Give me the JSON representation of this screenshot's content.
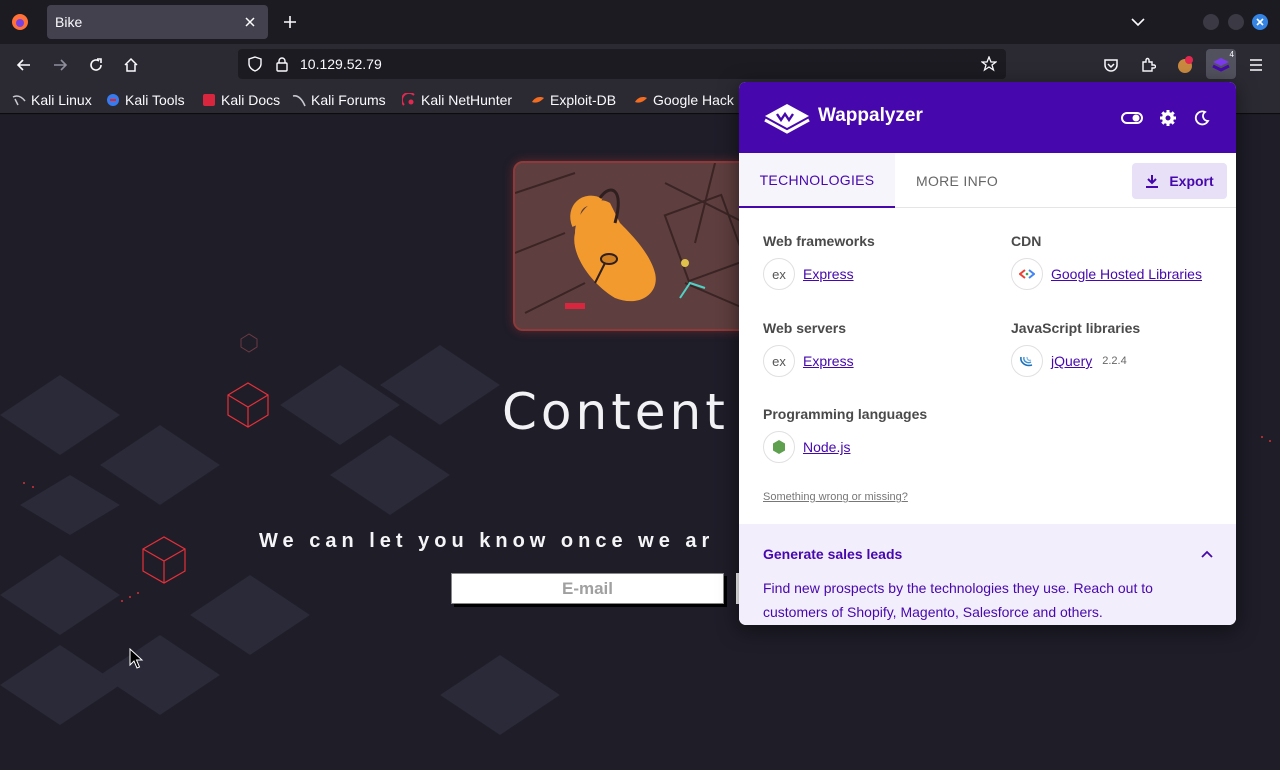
{
  "browser": {
    "tab_title": "Bike",
    "url": "10.129.52.79",
    "bookmarks": [
      {
        "label": "Kali Linux",
        "icon": "kali-dragon-icon"
      },
      {
        "label": "Kali Tools",
        "icon": "kali-tools-icon"
      },
      {
        "label": "Kali Docs",
        "icon": "kali-docs-icon"
      },
      {
        "label": "Kali Forums",
        "icon": "kali-forums-icon"
      },
      {
        "label": "Kali NetHunter",
        "icon": "nethunter-icon"
      },
      {
        "label": "Exploit-DB",
        "icon": "exploit-db-icon"
      },
      {
        "label": "Google Hack",
        "icon": "ghdb-icon"
      }
    ],
    "extension_badge": "4"
  },
  "page": {
    "title": "Content",
    "subtitle": "We can let you know once we ar",
    "email_placeholder": "E-mail"
  },
  "wappalyzer": {
    "brand": "Wappalyzer",
    "tabs": {
      "technologies": "TECHNOLOGIES",
      "more_info": "MORE INFO"
    },
    "export_label": "Export",
    "categories": [
      {
        "name": "Web frameworks",
        "techs": [
          {
            "name": "Express",
            "version": "",
            "icon": "express-icon"
          }
        ]
      },
      {
        "name": "CDN",
        "techs": [
          {
            "name": "Google Hosted Libraries",
            "version": "",
            "icon": "google-hosted-libraries-icon"
          }
        ]
      },
      {
        "name": "Web servers",
        "techs": [
          {
            "name": "Express",
            "version": "",
            "icon": "express-icon"
          }
        ]
      },
      {
        "name": "JavaScript libraries",
        "techs": [
          {
            "name": "jQuery",
            "version": "2.2.4",
            "icon": "jquery-icon"
          }
        ]
      },
      {
        "name": "Programming languages",
        "techs": [
          {
            "name": "Node.js",
            "version": "",
            "icon": "nodejs-icon"
          }
        ]
      }
    ],
    "something_wrong": "Something wrong or missing?",
    "leads": {
      "title": "Generate sales leads",
      "body": "Find new prospects by the technologies they use. Reach out to customers of Shopify, Magento, Salesforce and others."
    }
  }
}
